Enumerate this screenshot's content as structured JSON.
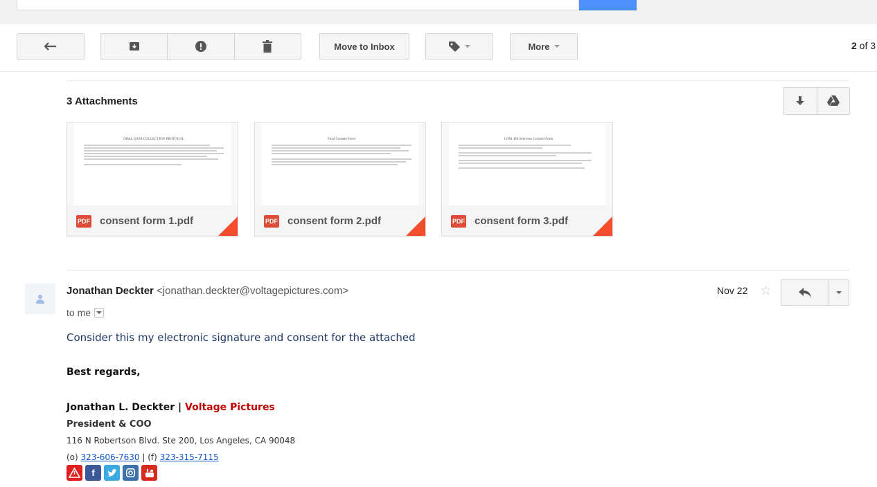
{
  "toolbar": {
    "move_to_inbox_label": "Move to Inbox",
    "more_label": "More",
    "counter_current": "2",
    "counter_rest": " of 3"
  },
  "attachments": {
    "title": "3 Attachments",
    "files": [
      {
        "name": "consent form 1.pdf",
        "type_badge": "PDF",
        "preview_title": "ORAL DATA COLLECTION PROTOCOL"
      },
      {
        "name": "consent form 2.pdf",
        "type_badge": "PDF",
        "preview_title": "Final Consent Form"
      },
      {
        "name": "consent form 3.pdf",
        "type_badge": "PDF",
        "preview_title": "COM 498 Interview Consent Form"
      }
    ]
  },
  "message": {
    "sender_name": "Jonathan Deckter",
    "sender_email": "<jonathan.deckter@voltagepictures.com>",
    "to": "to me",
    "date": "Nov 22",
    "body": "Consider this my electronic signature and consent for the attached",
    "closing": "Best regards,",
    "signature": {
      "name": "Jonathan L. Deckter",
      "separator": "|",
      "company": "Voltage Pictures",
      "title": "President & COO",
      "address": "116 N Robertson Blvd. Ste 200, Los Angeles, CA 90048",
      "phone_prefix": "(o)",
      "phone": "323-606-7630",
      "fax_prefix": "| (f)",
      "fax": "323-315-7115"
    }
  },
  "icons": [
    "back-arrow-icon",
    "archive-icon",
    "spam-icon",
    "trash-icon",
    "label-icon",
    "download-icon",
    "drive-icon",
    "pdf-icon",
    "star-icon",
    "reply-icon",
    "avatar-icon"
  ],
  "colors": {
    "pdf_red": "#dd4b39",
    "corner_orange": "#f54d2d",
    "company_red": "#c00000",
    "body_blue": "#1f3864",
    "link_blue": "#1155cc",
    "search_blue": "#4d90fe"
  },
  "social_icons": [
    {
      "name": "voltage-icon",
      "color": "#e02020"
    },
    {
      "name": "facebook-icon",
      "color": "#3b5998"
    },
    {
      "name": "twitter-icon",
      "color": "#3ba9e2"
    },
    {
      "name": "instagram-icon",
      "color": "#3f72a8"
    },
    {
      "name": "youtube-icon",
      "color": "#d62b1e"
    }
  ]
}
